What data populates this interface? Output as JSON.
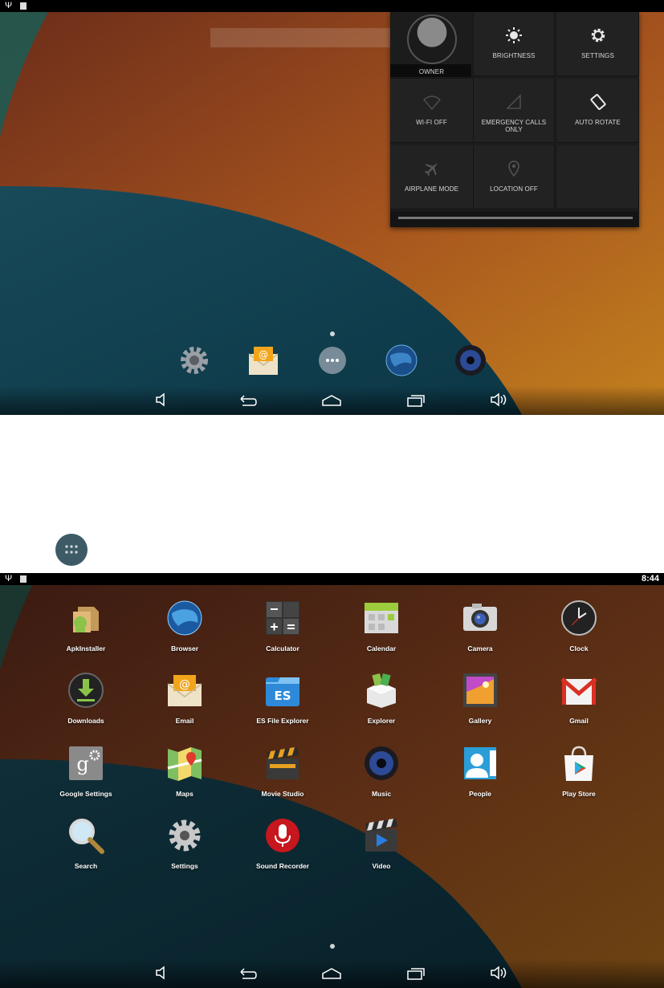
{
  "top_screen": {
    "status_bar": {
      "usb_icon": "usb-icon",
      "storage_icon": "sd-card-icon"
    },
    "quick_settings": {
      "owner_label": "OWNER",
      "tiles": [
        {
          "id": "brightness",
          "label": "BRIGHTNESS",
          "icon": "brightness-icon"
        },
        {
          "id": "settings",
          "label": "SETTINGS",
          "icon": "gear-icon"
        },
        {
          "id": "wifi",
          "label": "WI-FI OFF",
          "icon": "wifi-off-icon"
        },
        {
          "id": "signal",
          "label": "EMERGENCY CALLS ONLY",
          "icon": "signal-icon"
        },
        {
          "id": "rotate",
          "label": "AUTO ROTATE",
          "icon": "rotate-icon"
        },
        {
          "id": "airplane",
          "label": "AIRPLANE MODE",
          "icon": "airplane-icon"
        },
        {
          "id": "location",
          "label": "LOCATION OFF",
          "icon": "location-icon"
        }
      ]
    },
    "hotseat": [
      "settings-icon",
      "email-icon",
      "all-apps-icon",
      "browser-icon",
      "music-icon"
    ]
  },
  "middle": {
    "launcher_icon": "all-apps-icon"
  },
  "app_drawer": {
    "status_bar": {
      "time": "8:44"
    },
    "apps": [
      {
        "label": "ApkInstaller",
        "icon": "apkinstaller-icon"
      },
      {
        "label": "Browser",
        "icon": "browser-icon"
      },
      {
        "label": "Calculator",
        "icon": "calculator-icon"
      },
      {
        "label": "Calendar",
        "icon": "calendar-icon"
      },
      {
        "label": "Camera",
        "icon": "camera-icon"
      },
      {
        "label": "Clock",
        "icon": "clock-icon"
      },
      {
        "label": "Downloads",
        "icon": "downloads-icon"
      },
      {
        "label": "Email",
        "icon": "email-icon"
      },
      {
        "label": "ES File Explorer",
        "icon": "es-file-explorer-icon"
      },
      {
        "label": "Explorer",
        "icon": "explorer-icon"
      },
      {
        "label": "Gallery",
        "icon": "gallery-icon"
      },
      {
        "label": "Gmail",
        "icon": "gmail-icon"
      },
      {
        "label": "Google Settings",
        "icon": "google-settings-icon"
      },
      {
        "label": "Maps",
        "icon": "maps-icon"
      },
      {
        "label": "Movie Studio",
        "icon": "movie-studio-icon"
      },
      {
        "label": "Music",
        "icon": "music-icon"
      },
      {
        "label": "People",
        "icon": "people-icon"
      },
      {
        "label": "Play Store",
        "icon": "play-store-icon"
      },
      {
        "label": "Search",
        "icon": "search-icon"
      },
      {
        "label": "Settings",
        "icon": "settings-icon"
      },
      {
        "label": "Sound Recorder",
        "icon": "sound-recorder-icon"
      },
      {
        "label": "Video",
        "icon": "video-icon"
      }
    ]
  },
  "nav_bar": [
    "volume-down-icon",
    "back-icon",
    "home-icon",
    "recent-apps-icon",
    "volume-up-icon"
  ],
  "colors": {
    "wallpaper_orange": "#b8621e",
    "wallpaper_teal": "#0f4f5e",
    "wallpaper_dark": "#5a2a18",
    "panel": "#1c1c1c"
  }
}
